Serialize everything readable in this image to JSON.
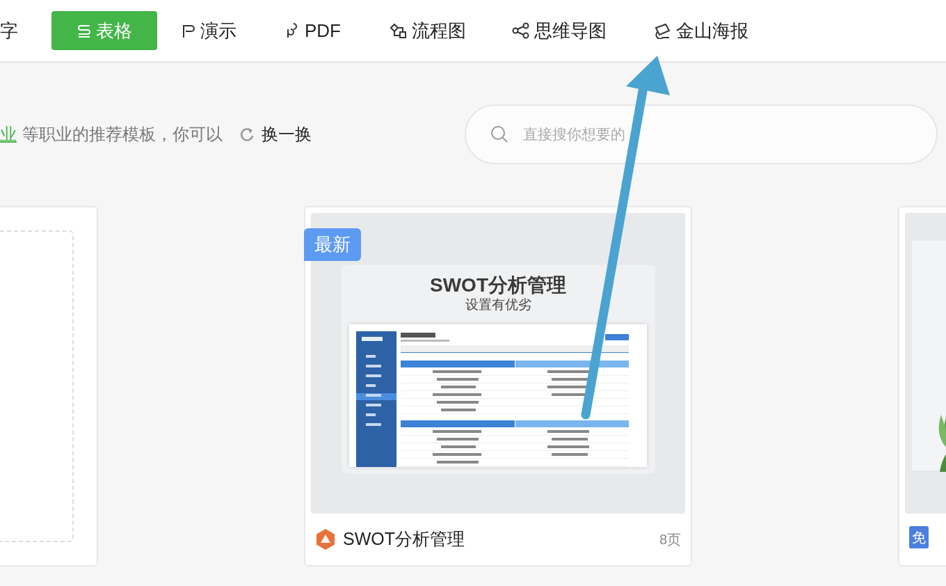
{
  "nav": {
    "tabs": [
      {
        "label": "字",
        "kind": "plain",
        "selected": false
      },
      {
        "label": "表格",
        "kind": "sheet",
        "selected": true
      },
      {
        "label": "演示",
        "kind": "slides",
        "selected": false
      },
      {
        "label": "PDF",
        "kind": "pdf",
        "selected": false
      },
      {
        "label": "流程图",
        "kind": "flow",
        "selected": false
      },
      {
        "label": "思维导图",
        "kind": "mind",
        "selected": false
      },
      {
        "label": "金山海报",
        "kind": "poster",
        "selected": false
      }
    ]
  },
  "recommend": {
    "link": "业",
    "text": "等职业的推荐模板，你可以",
    "refresh": "换一换"
  },
  "search": {
    "placeholder": "直接搜你想要的"
  },
  "cards": [
    {
      "kind": "blank"
    },
    {
      "kind": "template",
      "badge": "最新",
      "title": "SWOT分析管理",
      "pages": "8页",
      "preview": {
        "title": "SWOT分析管理",
        "subtitle": "设置有优劣"
      }
    },
    {
      "kind": "partial",
      "badge": "免"
    }
  ]
}
